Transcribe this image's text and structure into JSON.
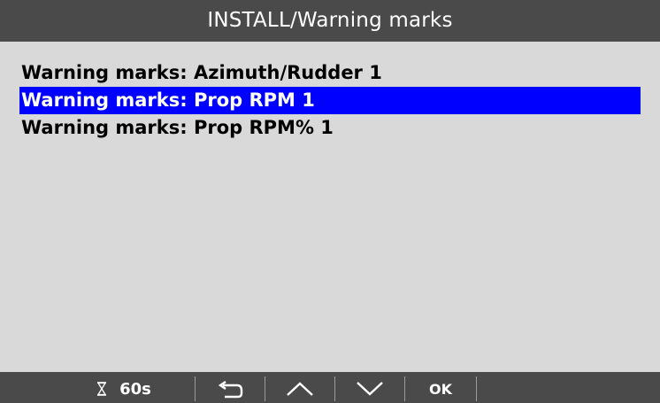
{
  "title": "INSTALL/Warning marks",
  "menu": {
    "items": [
      {
        "label": "Warning marks: Azimuth/Rudder 1",
        "selected": false
      },
      {
        "label": "Warning marks: Prop RPM 1",
        "selected": true
      },
      {
        "label": "Warning marks: Prop RPM% 1",
        "selected": false
      }
    ]
  },
  "bottom_bar": {
    "timer_icon": "hourglass-icon",
    "timer_label": "60s",
    "back_icon": "return-arrow-icon",
    "up_icon": "chevron-up-icon",
    "down_icon": "chevron-down-icon",
    "ok_label": "OK"
  },
  "colors": {
    "bar_background": "#4a4a4a",
    "screen_background": "#d9d9d9",
    "selection": "#0000ff",
    "text": "#000000",
    "bar_text": "#ffffff"
  }
}
